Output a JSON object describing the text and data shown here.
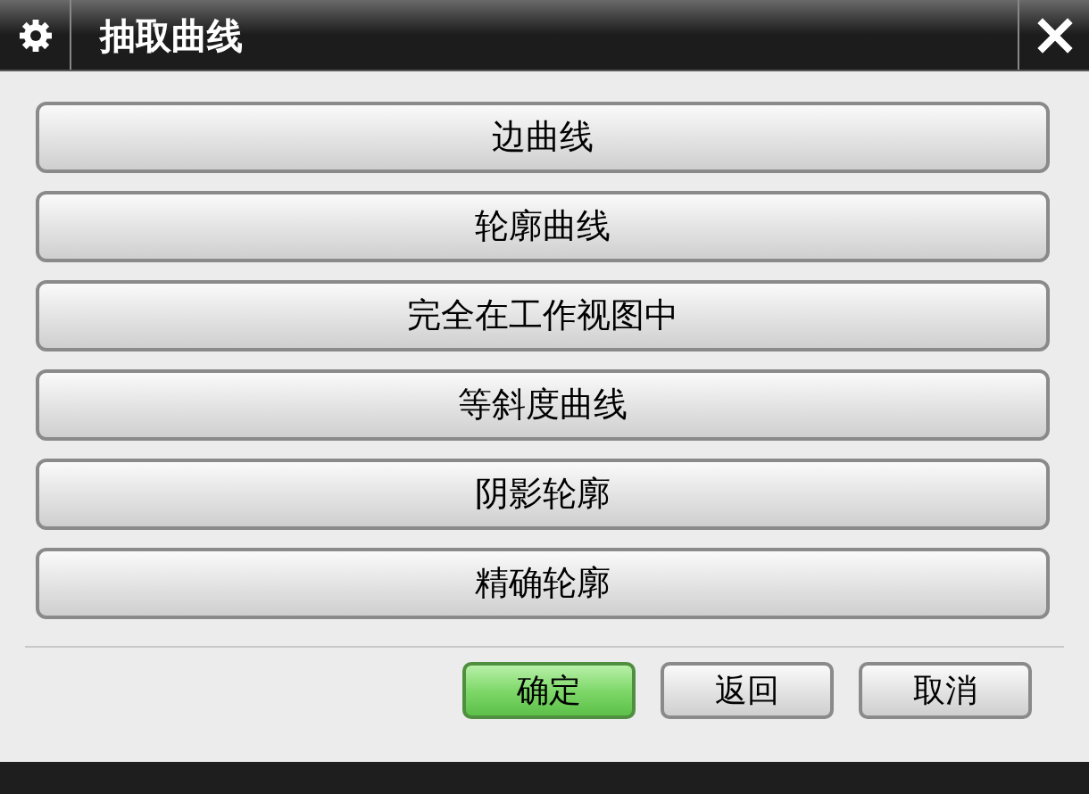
{
  "window": {
    "title": "抽取曲线"
  },
  "options": [
    "边曲线",
    "轮廓曲线",
    "完全在工作视图中",
    "等斜度曲线",
    "阴影轮廓",
    "精确轮廓"
  ],
  "buttons": [
    {
      "label": "确定",
      "default": true
    },
    {
      "label": "返回",
      "default": false
    },
    {
      "label": "取消",
      "default": false
    }
  ]
}
